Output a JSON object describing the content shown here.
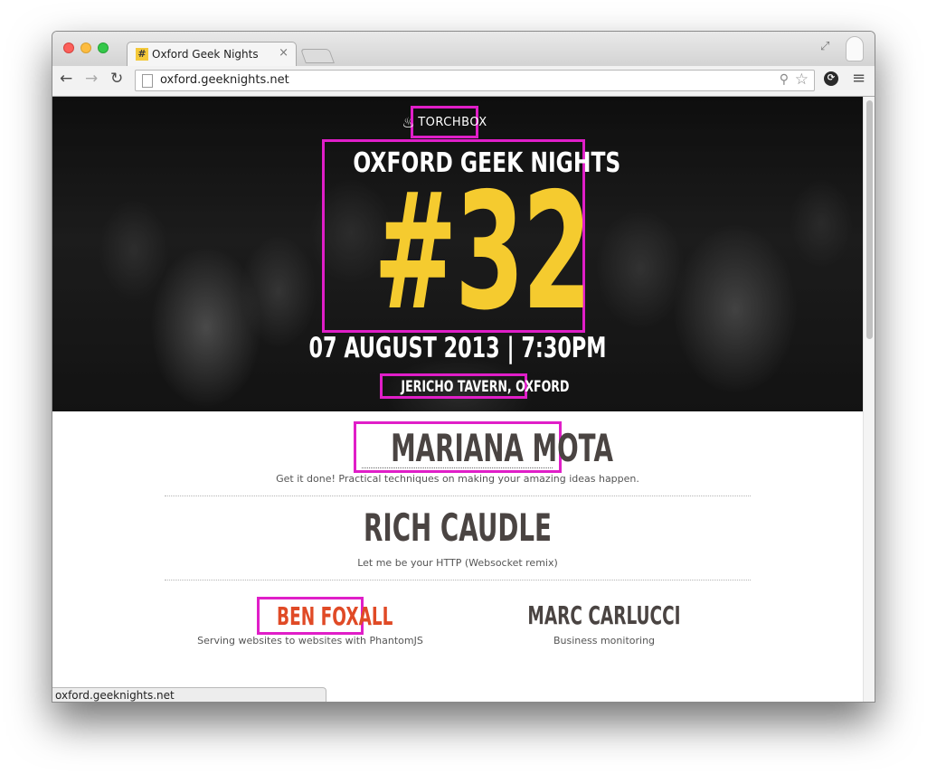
{
  "browser": {
    "tab_title": "Oxford Geek Nights",
    "favicon_glyph": "#",
    "tab_close": "×",
    "url": "oxford.geeknights.net",
    "status_url": "oxford.geeknights.net",
    "icons": {
      "back": "←",
      "forward": "→",
      "reload": "↻",
      "zoom": "⚲",
      "bookmark": "☆",
      "menu": "≡",
      "restore": "⤢"
    }
  },
  "hero": {
    "logo_text": "TORCHBOX",
    "event_title": "OXFORD GEEK NIGHTS",
    "event_number": "#32",
    "event_date": "07 AUGUST 2013 | 7:30PM",
    "event_venue": "JERICHO TAVERN, OXFORD"
  },
  "speakers": [
    {
      "name": "MARIANA MOTA",
      "talk": "Get it done! Practical techniques on making your amazing ideas happen."
    },
    {
      "name": "RICH CAUDLE",
      "talk": "Let me be your HTTP (Websocket remix)"
    },
    {
      "name": "BEN FOXALL",
      "talk": "Serving websites to websites with PhantomJS"
    },
    {
      "name": "MARC CARLUCCI",
      "talk": "Business monitoring"
    }
  ],
  "colors": {
    "accent_yellow": "#f5cb2f",
    "highlight_magenta": "#e01ec8",
    "speaker_hover_red": "#e04a26",
    "speaker_text": "#4a4442"
  }
}
